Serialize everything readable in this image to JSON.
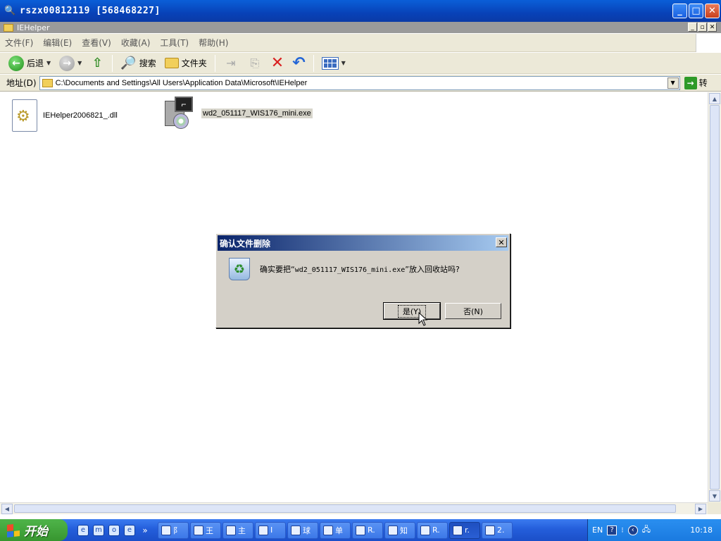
{
  "window": {
    "title": "rszx00812119 [568468227]"
  },
  "inner_window": {
    "title": "IEHelper"
  },
  "menu": [
    "文件(F)",
    "编辑(E)",
    "查看(V)",
    "收藏(A)",
    "工具(T)",
    "帮助(H)"
  ],
  "toolbar": {
    "back_label": "后退",
    "search_label": "搜索",
    "folders_label": "文件夹"
  },
  "address": {
    "label": "地址(D)",
    "path": "C:\\Documents and Settings\\All Users\\Application Data\\Microsoft\\IEHelper",
    "go_label": "转"
  },
  "files": [
    {
      "name": "IEHelper2006821_.dll",
      "icon": "dll-file-icon",
      "selected": false
    },
    {
      "name": "wd2_051117_WIS176_mini.exe",
      "icon": "installer-exe-icon",
      "selected": true
    }
  ],
  "dialog": {
    "title": "确认文件删除",
    "message_prefix": "确实要把“",
    "message_file": "wd2_051117_WIS176_mini.exe",
    "message_suffix": "”放入回收站吗?",
    "yes_label": "是(Y)",
    "no_label": "否(N)"
  },
  "taskbar": {
    "start_label": "开始",
    "tasks": [
      "阝",
      "王",
      "主",
      "I",
      "球",
      "单",
      "R.",
      "知",
      "R.",
      "r.",
      "2."
    ],
    "active_task_index": 9,
    "tray_lang": "EN",
    "clock": "10:18"
  },
  "colors": {
    "titlebar": "#0842b8",
    "dialog_title": "#0a246a",
    "taskbar": "#245edb",
    "start": "#37962f"
  }
}
